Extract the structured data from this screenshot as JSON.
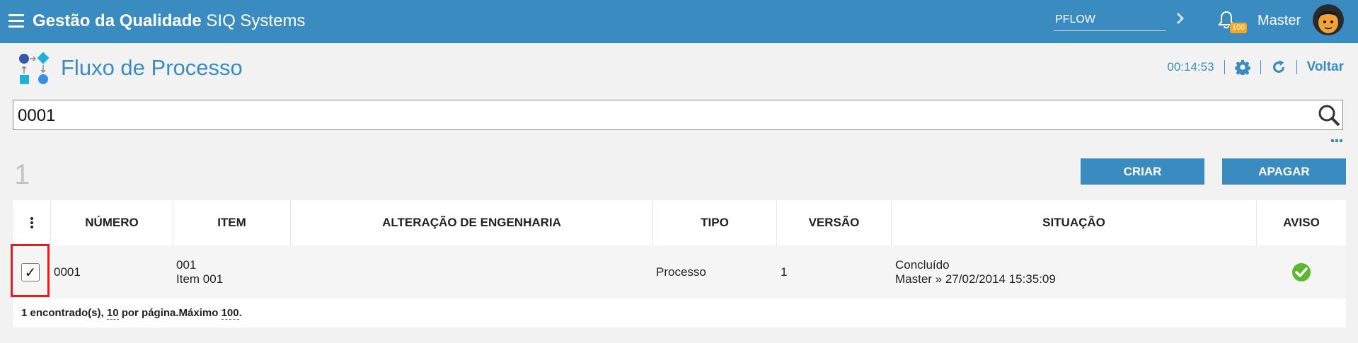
{
  "topbar": {
    "app_title_bold": "Gestão da Qualidade",
    "app_title_rest": "SIQ Systems",
    "module_value": "PFLOW",
    "notification_count": "100",
    "user_name": "Master"
  },
  "page": {
    "title": "Fluxo de Processo",
    "timer": "00:14:53",
    "back_label": "Voltar"
  },
  "search": {
    "value": "0001"
  },
  "results": {
    "count": "1",
    "create_label": "CRIAR",
    "delete_label": "APAGAR"
  },
  "table": {
    "columns": [
      "NÚMERO",
      "ITEM",
      "ALTERAÇÃO DE ENGENHARIA",
      "TIPO",
      "VERSÃO",
      "SITUAÇÃO",
      "AVISO"
    ],
    "rows": [
      {
        "checked": "✓",
        "numero": "0001",
        "item_code": "001",
        "item_name": "Item 001",
        "alteracao": "",
        "tipo": "Processo",
        "versao": "1",
        "situacao": "Concluído",
        "situacao_detail": "Master » 27/02/2014 15:35:09",
        "aviso_icon": "check-circle-icon"
      }
    ],
    "footer": {
      "found_text": "1 encontrado(s),",
      "per_page_value": "10",
      "per_page_text": "por página.Máximo",
      "max_value": "100",
      "end": "."
    }
  },
  "colors": {
    "primary": "#3a8bbf",
    "success": "#5cb82e",
    "badge": "#f5a623",
    "highlight": "#e02020"
  }
}
